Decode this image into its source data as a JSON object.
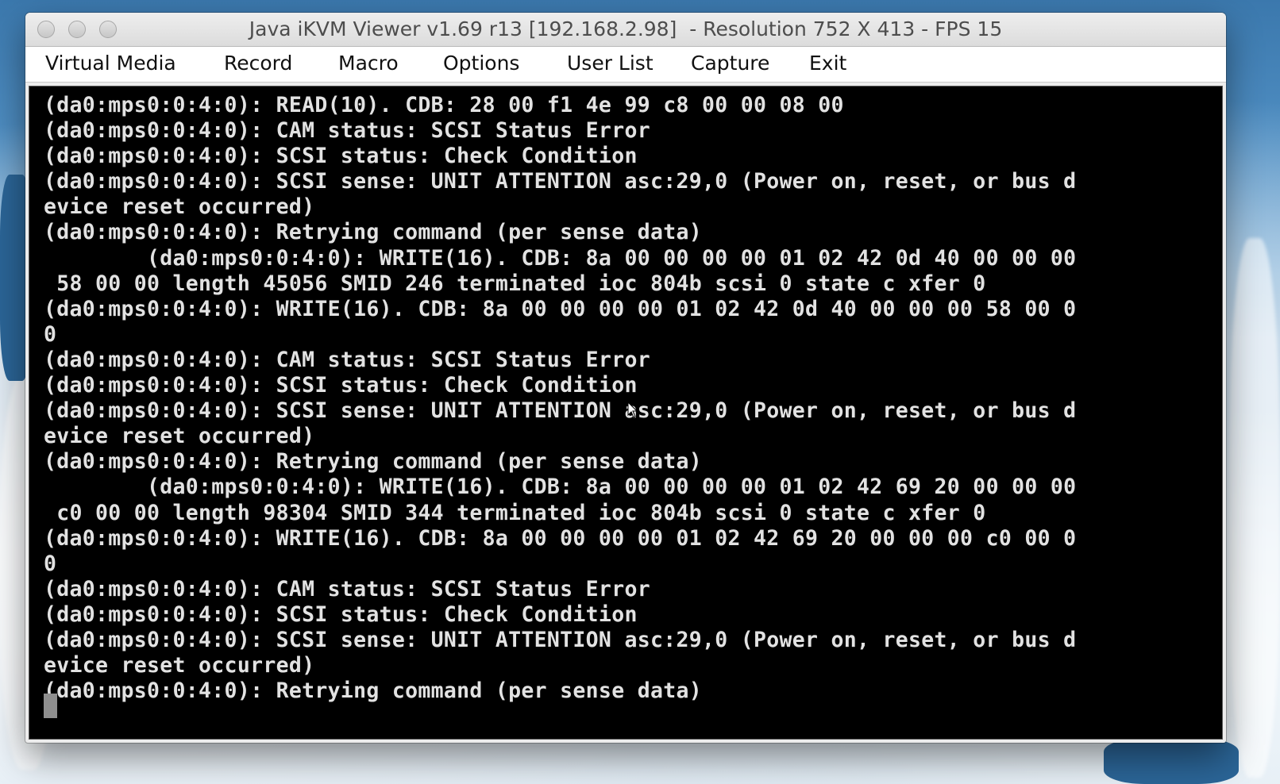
{
  "window": {
    "title": "Java iKVM Viewer v1.69 r13 [192.168.2.98]  - Resolution 752 X 413 - FPS 15"
  },
  "menu": {
    "items": [
      {
        "label": "Virtual Media"
      },
      {
        "label": "Record"
      },
      {
        "label": "Macro"
      },
      {
        "label": "Options"
      },
      {
        "label": "User List"
      },
      {
        "label": "Capture"
      },
      {
        "label": "Exit"
      }
    ]
  },
  "console": {
    "lines": [
      "(da0:mps0:0:4:0): READ(10). CDB: 28 00 f1 4e 99 c8 00 00 08 00",
      "(da0:mps0:0:4:0): CAM status: SCSI Status Error",
      "(da0:mps0:0:4:0): SCSI status: Check Condition",
      "(da0:mps0:0:4:0): SCSI sense: UNIT ATTENTION asc:29,0 (Power on, reset, or bus d",
      "evice reset occurred)",
      "(da0:mps0:0:4:0): Retrying command (per sense data)",
      "        (da0:mps0:0:4:0): WRITE(16). CDB: 8a 00 00 00 00 01 02 42 0d 40 00 00 00",
      " 58 00 00 length 45056 SMID 246 terminated ioc 804b scsi 0 state c xfer 0",
      "(da0:mps0:0:4:0): WRITE(16). CDB: 8a 00 00 00 00 01 02 42 0d 40 00 00 00 58 00 0",
      "0",
      "(da0:mps0:0:4:0): CAM status: SCSI Status Error",
      "(da0:mps0:0:4:0): SCSI status: Check Condition",
      "(da0:mps0:0:4:0): SCSI sense: UNIT ATTENTION asc:29,0 (Power on, reset, or bus d",
      "evice reset occurred)",
      "(da0:mps0:0:4:0): Retrying command (per sense data)",
      "        (da0:mps0:0:4:0): WRITE(16). CDB: 8a 00 00 00 00 01 02 42 69 20 00 00 00",
      " c0 00 00 length 98304 SMID 344 terminated ioc 804b scsi 0 state c xfer 0",
      "(da0:mps0:0:4:0): WRITE(16). CDB: 8a 00 00 00 00 01 02 42 69 20 00 00 00 c0 00 0",
      "0",
      "(da0:mps0:0:4:0): CAM status: SCSI Status Error",
      "(da0:mps0:0:4:0): SCSI status: Check Condition",
      "(da0:mps0:0:4:0): SCSI sense: UNIT ATTENTION asc:29,0 (Power on, reset, or bus d",
      "evice reset occurred)",
      "(da0:mps0:0:4:0): Retrying command (per sense data)"
    ]
  },
  "colors": {
    "console_background": "#000000",
    "console_text": "#e2e2e2",
    "cursor": "#8f8f8f"
  }
}
